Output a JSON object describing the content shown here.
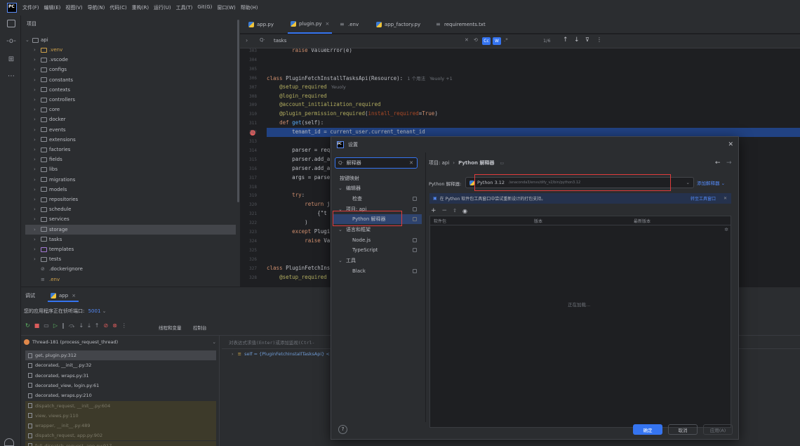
{
  "menubar": {
    "logo": "PC",
    "items": [
      "文件(F)",
      "编辑(E)",
      "视图(V)",
      "导航(N)",
      "代码(C)",
      "重构(R)",
      "运行(U)",
      "工具(T)",
      "Git(G)",
      "窗口(W)",
      "帮助(H)"
    ]
  },
  "project": {
    "title": "项目",
    "root": "api",
    "items": [
      ".venv",
      ".vscode",
      "configs",
      "constants",
      "contexts",
      "controllers",
      "core",
      "docker",
      "events",
      "extensions",
      "factories",
      "fields",
      "libs",
      "migrations",
      "models",
      "repositories",
      "schedule",
      "services",
      "storage",
      "tasks",
      "templates",
      "tests",
      ".dockerignore",
      ".env"
    ]
  },
  "tabs": [
    "app.py",
    "plugin.py",
    ".env",
    "app_factory.py",
    "requirements.txt"
  ],
  "find": {
    "query": "tasks",
    "count": "1/6",
    "cc": "Cc",
    "w": "W",
    "regex": ".*"
  },
  "code": [
    {
      "n": "303",
      "t": "        raise ValueError(e)"
    },
    {
      "n": "304",
      "t": ""
    },
    {
      "n": "305",
      "t": ""
    },
    {
      "n": "306",
      "t": "class PluginFetchInstallTasksApi(Resource):",
      "hint": "1 个用法   Yeuoly +1"
    },
    {
      "n": "307",
      "t": "    @setup_required",
      "hint": "Yeuoly"
    },
    {
      "n": "308",
      "t": "    @login_required"
    },
    {
      "n": "309",
      "t": "    @account_initialization_required"
    },
    {
      "n": "310",
      "t": "    @plugin_permission_required(install_required=True)"
    },
    {
      "n": "311",
      "t": "    def get(self):"
    },
    {
      "n": "312",
      "t": "        tenant_id = current_user.current_tenant_id"
    },
    {
      "n": "313",
      "t": ""
    },
    {
      "n": "314",
      "t": "        parser = req"
    },
    {
      "n": "315",
      "t": "        parser.add_a"
    },
    {
      "n": "316",
      "t": "        parser.add_a"
    },
    {
      "n": "317",
      "t": "        args = parse"
    },
    {
      "n": "318",
      "t": ""
    },
    {
      "n": "319",
      "t": "        try:"
    },
    {
      "n": "320",
      "t": "            return j"
    },
    {
      "n": "321",
      "t": "                {\"t"
    },
    {
      "n": "322",
      "t": "            )"
    },
    {
      "n": "323",
      "t": "        except Plugi"
    },
    {
      "n": "324",
      "t": "            raise Va"
    },
    {
      "n": "325",
      "t": ""
    },
    {
      "n": "326",
      "t": ""
    },
    {
      "n": "327",
      "t": "class PluginFetchIns"
    },
    {
      "n": "328",
      "t": "    @setup_required"
    }
  ],
  "debug": {
    "tab1": "调试",
    "tab2": "app",
    "listening": "您的应用程序正在侦听端口:",
    "port": "5001",
    "sub_tab1": "线程和变量",
    "sub_tab2": "控制台",
    "thread": "Thread-181 (process_request_thread)",
    "eval_placeholder": "对表达式求值(Enter)或添加监视(Ctrl-",
    "var": "self = {PluginFetchInstallTasksApi} <",
    "frames": [
      {
        "t": "get, plugin.py:312",
        "k": "sel"
      },
      {
        "t": "decorated, __init__.py:32",
        "k": "app"
      },
      {
        "t": "decorated, wraps.py:31",
        "k": "app"
      },
      {
        "t": "decorated_view, login.py:61",
        "k": "app"
      },
      {
        "t": "decorated, wraps.py:210",
        "k": "app"
      },
      {
        "t": "dispatch_request, __init__.py:604",
        "k": "lib"
      },
      {
        "t": "view, views.py:110",
        "k": "lib"
      },
      {
        "t": "wrapper, __init__.py:489",
        "k": "lib"
      },
      {
        "t": "dispatch_request, app.py:902",
        "k": "lib"
      },
      {
        "t": "full_dispatch_request, app.py:917",
        "k": "lib"
      }
    ]
  },
  "dialog": {
    "logo": "PC",
    "title": "设置",
    "search": "解释器",
    "nav": [
      {
        "t": "按键映射",
        "lvl": 0,
        "chev": ""
      },
      {
        "t": "编辑器",
        "lvl": 0,
        "chev": "⌄"
      },
      {
        "t": "检查",
        "lvl": 1,
        "chev": ""
      },
      {
        "t": "项目: api",
        "lvl": 0,
        "chev": "⌄"
      },
      {
        "t": "Python 解释器",
        "lvl": 1,
        "chev": "",
        "sel": true
      },
      {
        "t": "语言和框架",
        "lvl": 0,
        "chev": "⌄"
      },
      {
        "t": "Node.js",
        "lvl": 1,
        "chev": ""
      },
      {
        "t": "TypeScript",
        "lvl": 1,
        "chev": ""
      },
      {
        "t": "工具",
        "lvl": 0,
        "chev": "⌄"
      },
      {
        "t": "Black",
        "lvl": 1,
        "chev": ""
      }
    ],
    "crumb1": "项目: api",
    "crumb2": "Python 解释器",
    "interp_label": "Python 解释器:",
    "interp_value": "Python 3.12",
    "interp_path": "/anaconda3/envs/dify_v2/bin/python3.12",
    "add_interp": "添加解释器",
    "info": "在 Python 软件包工具窗口中尝试重新设计的打包支持。",
    "info_link": "转至工具窗口",
    "cols": [
      "软件包",
      "版本",
      "最新版本"
    ],
    "loading": "正在加载...",
    "ok": "确定",
    "cancel": "取消",
    "apply": "应用(A)"
  }
}
